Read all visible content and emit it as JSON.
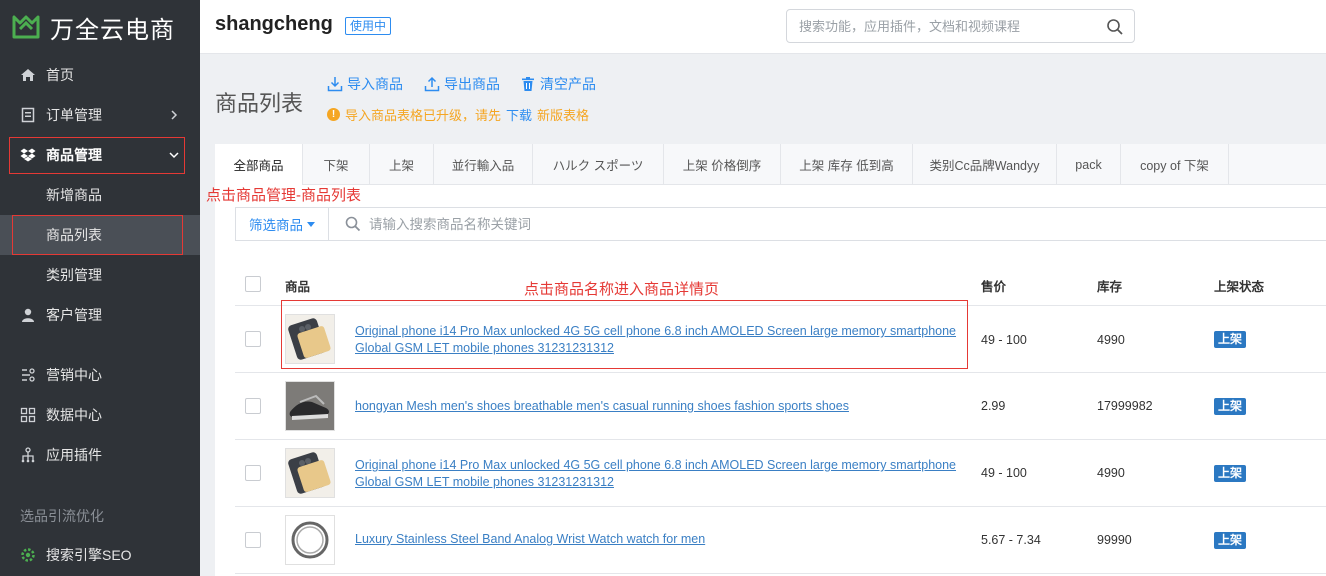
{
  "brand": {
    "name": "万全云电商"
  },
  "sidebar": {
    "items": [
      {
        "label": "首页",
        "icon": "home-icon"
      },
      {
        "label": "订单管理",
        "icon": "order-icon"
      },
      {
        "label": "商品管理",
        "icon": "dropbox-icon"
      },
      {
        "label": "新增商品"
      },
      {
        "label": "商品列表"
      },
      {
        "label": "类别管理"
      },
      {
        "label": "客户管理",
        "icon": "user-icon"
      },
      {
        "label": "营销中心",
        "icon": "marketing-icon"
      },
      {
        "label": "数据中心",
        "icon": "data-icon"
      },
      {
        "label": "应用插件",
        "icon": "plugin-icon"
      }
    ],
    "section_label": "选品引流优化",
    "seo_item": {
      "label": "搜索引擎SEO",
      "icon": "gear-icon"
    }
  },
  "header": {
    "store_name": "shangcheng",
    "store_badge": "使用中",
    "search_placeholder": "搜索功能，应用插件，文档和视频课程"
  },
  "page": {
    "title": "商品列表",
    "actions": {
      "import": "导入商品",
      "export": "导出商品",
      "clear": "清空产品"
    },
    "notice": {
      "prefix": "导入商品表格已升级，请先",
      "link": "下载",
      "suffix": "新版表格"
    }
  },
  "tabs": [
    "全部商品",
    "下架",
    "上架",
    "並行輸入品",
    "ハルク スポーツ",
    "上架 价格倒序",
    "上架 库存 低到高",
    "类别Cc品牌Wandyy",
    "pack",
    "copy of 下架"
  ],
  "filter": {
    "button_label": "筛选商品",
    "search_placeholder": "请输入搜索商品名称关键词"
  },
  "table": {
    "headers": {
      "product": "商品",
      "price": "售价",
      "stock": "库存",
      "status": "上架状态"
    },
    "rows": [
      {
        "name": "Original phone i14 Pro Max unlocked 4G 5G cell phone 6.8 inch AMOLED Screen large memory smartphone Global GSM LET mobile phones 31231231312",
        "price": "49 - 100",
        "stock": "4990",
        "status": "上架",
        "thumb": "phone"
      },
      {
        "name": "hongyan Mesh men's shoes breathable men's casual running shoes fashion sports shoes",
        "price": "2.99",
        "stock": "17999982",
        "status": "上架",
        "thumb": "shoe"
      },
      {
        "name": "Original phone i14 Pro Max unlocked 4G 5G cell phone 6.8 inch AMOLED Screen large memory smartphone Global GSM LET mobile phones 31231231312",
        "price": "49 - 100",
        "stock": "4990",
        "status": "上架",
        "thumb": "phone"
      },
      {
        "name": "Luxury Stainless Steel Band Analog Wrist Watch watch for men",
        "price": "5.67 - 7.34",
        "stock": "99990",
        "status": "上架",
        "thumb": "watch"
      }
    ]
  },
  "annotations": {
    "menu_hint": "点击商品管理-商品列表",
    "detail_hint": "点击商品名称进入商品详情页"
  },
  "colors": {
    "accent": "#2d8cf0",
    "sidebar_bg": "#2f3338",
    "annotation": "#e53935",
    "notice": "#f5a623",
    "status_badge": "#2b78c2"
  }
}
